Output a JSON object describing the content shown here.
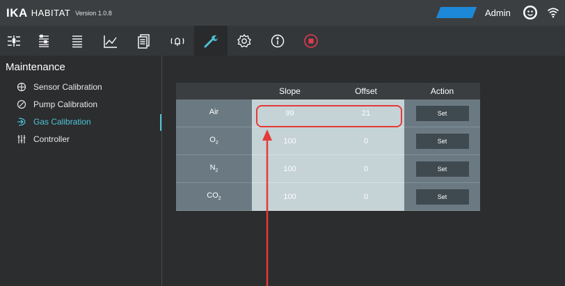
{
  "titlebar": {
    "brand_bold": "IKA",
    "brand_name": "HABITAT",
    "version": "Version 1.0.8",
    "user_label": "Admin",
    "status_color": "#1e88d8"
  },
  "toolbar": {
    "items": [
      {
        "icon": "sliders-icon"
      },
      {
        "icon": "control-panel-icon"
      },
      {
        "icon": "list-icon"
      },
      {
        "icon": "chart-icon"
      },
      {
        "icon": "report-icon"
      },
      {
        "icon": "alarm-icon"
      },
      {
        "icon": "wrench-icon",
        "active": true
      },
      {
        "icon": "gear-icon"
      },
      {
        "icon": "info-icon"
      },
      {
        "icon": "stop-icon"
      }
    ]
  },
  "sidebar": {
    "title": "Maintenance",
    "items": [
      {
        "label": "Sensor Calibration",
        "icon": "crosshair-icon"
      },
      {
        "label": "Pump Calibration",
        "icon": "gauge-icon"
      },
      {
        "label": "Gas Calibration",
        "icon": "gas-inlet-icon",
        "active": true
      },
      {
        "label": "Controller",
        "icon": "controller-sliders-icon"
      }
    ],
    "accent_color": "#4fc3d7"
  },
  "table": {
    "headers": [
      "",
      "Slope",
      "Offset",
      "Action"
    ],
    "rows": [
      {
        "gas": "Air",
        "sub": "",
        "slope": "99",
        "offset": "21",
        "action": "Set"
      },
      {
        "gas": "O",
        "sub": "2",
        "slope": "100",
        "offset": "0",
        "action": "Set"
      },
      {
        "gas": "N",
        "sub": "2",
        "slope": "100",
        "offset": "0",
        "action": "Set"
      },
      {
        "gas": "CO",
        "sub": "2",
        "slope": "100",
        "offset": "0",
        "action": "Set"
      }
    ]
  },
  "annotation": {
    "highlight_color": "#e53935"
  }
}
